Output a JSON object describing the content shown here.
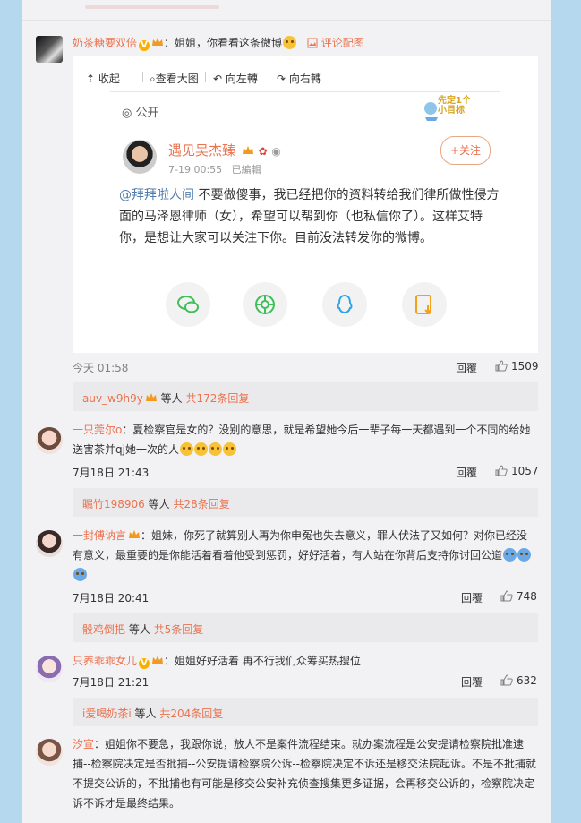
{
  "comments": [
    {
      "user": "奶茶糖要双倍",
      "text": "：姐姐，你看看这条微博",
      "action_link": "评论配图",
      "time": "今天 01:58",
      "reply_label": "回覆",
      "likes": "1509",
      "sub_user": "auv_w9h9y",
      "sub_mid": " 等人 ",
      "sub_count": "共172条回复"
    },
    {
      "user": "一只莞尔o",
      "text": "：夏检察官是女的？没别的意思，就是希望她今后一辈子每一天都遇到一个不同的给她送害茶并qj她一次的人",
      "time": "7月18日 21:43",
      "reply_label": "回覆",
      "likes": "1057",
      "sub_user": "瞩竹198906",
      "sub_mid": " 等人 ",
      "sub_count": "共28条回复"
    },
    {
      "user": "一封傅讷言",
      "text": "：姐妹，你死了就算别人再为你申冤也失去意义，罪人伏法了又如何？对你已经没有意义，最重要的是你能活着看着他受到惩罚，好好活着，有人站在你背后支持你讨回公道",
      "time": "7月18日 20:41",
      "reply_label": "回覆",
      "likes": "748",
      "sub_user": "骰鸡倒把",
      "sub_mid": " 等人 ",
      "sub_count": "共5条回复"
    },
    {
      "user": "只养乖乖女儿",
      "text": "：姐姐好好活着 再不行我们众筹买热搜位",
      "time": "7月18日 21:21",
      "reply_label": "回覆",
      "likes": "632",
      "sub_user": "i爱喝奶茶i",
      "sub_mid": " 等人 ",
      "sub_count": "共204条回复"
    },
    {
      "user": "汐宣",
      "text": "：姐姐你不要急，我跟你说，放人不是案件流程结束。就办案流程是公安提请检察院批准逮捕--检察院决定是否批捕--公安提请检察院公诉--检察院决定不诉还是移交法院起诉。不是不批捕就不提交公诉的，不批捕也有可能是移交公安补充侦查搜集更多证据，会再移交公诉的，检察院决定诉不诉才是最终结果。"
    }
  ],
  "image_viewer": {
    "toolbar": [
      "收起",
      "查看大图",
      "向左轉",
      "向右轉"
    ],
    "visibility": "公开",
    "sticker_text": "先定1个小目标",
    "post": {
      "author": "遇见吴杰臻",
      "time": "7-19 00:55",
      "edited": "已編輯",
      "follow_label": "+关注",
      "mention": "@拜拜啦人间",
      "text": " 不要做傻事，我已经把你的资料转给我们律所做性侵方面的马泽恩律师（女），希望可以帮到你（也私信你了）。这样艾特你，是想让大家可以关注下你。目前没法转发你的微博。"
    },
    "share_icons": [
      "wechat-icon",
      "moments-icon",
      "qq-icon",
      "save-image-icon"
    ]
  },
  "colors": {
    "accent": "#eb7350",
    "background": "#b5d8ee",
    "panel": "#f2f2f5",
    "subreply": "#eaeaec"
  }
}
